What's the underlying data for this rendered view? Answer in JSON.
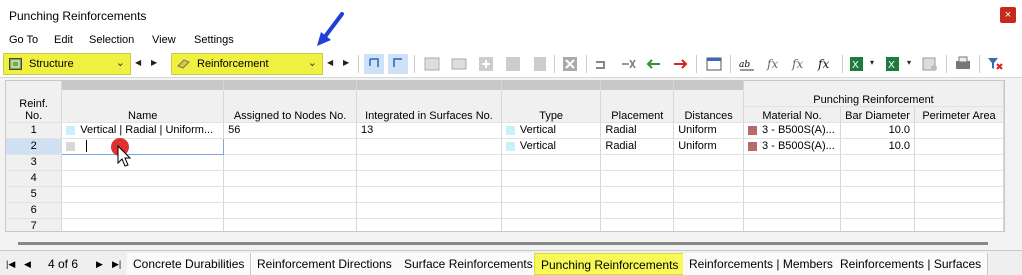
{
  "window": {
    "title": "Punching Reinforcements",
    "close_label": "×"
  },
  "menu": {
    "items": [
      "Go To",
      "Edit",
      "Selection",
      "View",
      "Settings"
    ]
  },
  "toolbar": {
    "combo1_label": "Structure",
    "combo2_label": "Reinforcement",
    "highlight_color": "#f0f040"
  },
  "table": {
    "group_header": "Punching Reinforcement",
    "headers": {
      "reinf_no": [
        "Reinf.",
        "No."
      ],
      "name": "Name",
      "nodes": "Assigned to Nodes No.",
      "surfaces": "Integrated in Surfaces No.",
      "type": "Type",
      "placement": "Placement",
      "distances": "Distances",
      "material": "Material No.",
      "bar_diameter": "Bar Diameter",
      "perimeter_area": "Perimeter Area"
    },
    "rows": [
      {
        "no": "1",
        "name": "Vertical | Radial | Uniform...",
        "nodes": "56",
        "surfaces": "13",
        "type": "Vertical",
        "placement": "Radial",
        "distances": "Uniform",
        "material": "3 - B500S(A)...",
        "bar_diameter": "10.0",
        "perimeter_area": ""
      },
      {
        "no": "2",
        "name": "",
        "nodes": "",
        "surfaces": "",
        "type": "Vertical",
        "placement": "Radial",
        "distances": "Uniform",
        "material": "3 - B500S(A)...",
        "bar_diameter": "10.0",
        "perimeter_area": ""
      },
      {
        "no": "3"
      },
      {
        "no": "4"
      },
      {
        "no": "5"
      },
      {
        "no": "6"
      },
      {
        "no": "7"
      }
    ],
    "type_color": "#c8f0f8",
    "material_color": "#b86a6a"
  },
  "pager": {
    "text": "4 of 6"
  },
  "tabs": [
    "Concrete Durabilities",
    "Reinforcement Directions",
    "Surface Reinforcements",
    "Punching Reinforcements",
    "Reinforcements | Members",
    "Reinforcements | Surfaces"
  ],
  "active_tab": "Punching Reinforcements"
}
